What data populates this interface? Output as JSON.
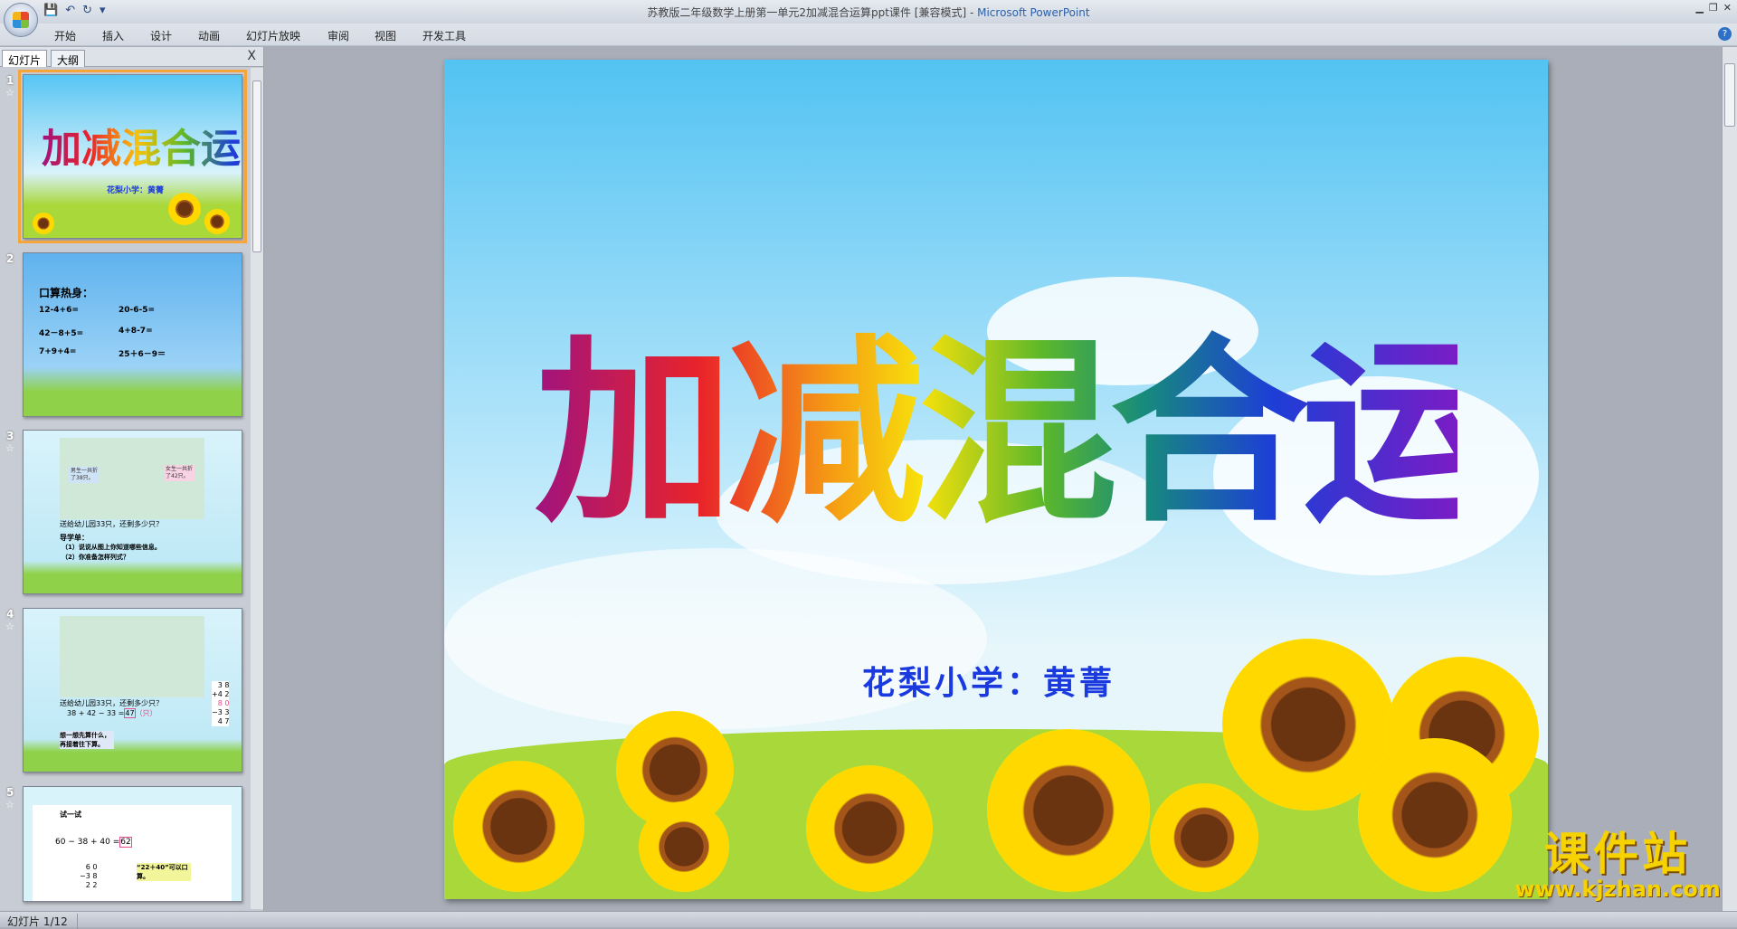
{
  "window": {
    "title": "苏教版二年级数学上册第一单元2加减混合运算ppt课件 [兼容模式]",
    "app_name": "Microsoft PowerPoint",
    "separator": " - "
  },
  "quick_access": {
    "save": "save-icon",
    "undo": "undo-icon",
    "redo": "redo-icon"
  },
  "ribbon": {
    "tabs": [
      "开始",
      "插入",
      "设计",
      "动画",
      "幻灯片放映",
      "审阅",
      "视图",
      "开发工具"
    ]
  },
  "pane": {
    "tabs": [
      "幻灯片",
      "大纲"
    ],
    "close": "X"
  },
  "thumbnails": [
    {
      "num": "1",
      "title": "加减混合运算",
      "subtitle": "花梨小学：黄菁"
    },
    {
      "num": "2",
      "heading": "口算热身：",
      "lines": [
        "12-4+6=",
        "20-6-5=",
        "42－8+5=",
        "4+8-7=",
        "7+9+4=",
        "25＋6－9＝"
      ]
    },
    {
      "num": "3",
      "bubble_boy": "男生一共折了38只。",
      "bubble_girl": "女生一共折了42只。",
      "question": "送给幼儿园33只，还剩多少只？",
      "guide": "导学单：",
      "guide_items": [
        "（1）说说从图上你知道哪些信息。",
        "（2）你准备怎样列式？"
      ]
    },
    {
      "num": "4",
      "question": "送给幼儿园33只，还剩多少只？",
      "equation": "38 + 42 − 33 =",
      "answer": "47",
      "unit": "（只）",
      "hint": "想一想先算什么，再接着往下算。",
      "vertical": [
        "3 8",
        "+4 2",
        "8 0",
        "−3 3",
        "4 7"
      ]
    },
    {
      "num": "5",
      "label": "试一试",
      "equation": "60 − 38 + 40 =",
      "answer": "62",
      "vertical": [
        "6 0",
        "−3 8",
        "2 2"
      ],
      "hint": "“22＋40”可以口算。"
    }
  ],
  "slide": {
    "title": "加减混合运算",
    "subtitle": "花梨小学：黄菁"
  },
  "watermark": {
    "name": "课件站",
    "url": "www.kjzhan.com"
  },
  "status": {
    "slide_count": "幻灯片 1/12"
  }
}
